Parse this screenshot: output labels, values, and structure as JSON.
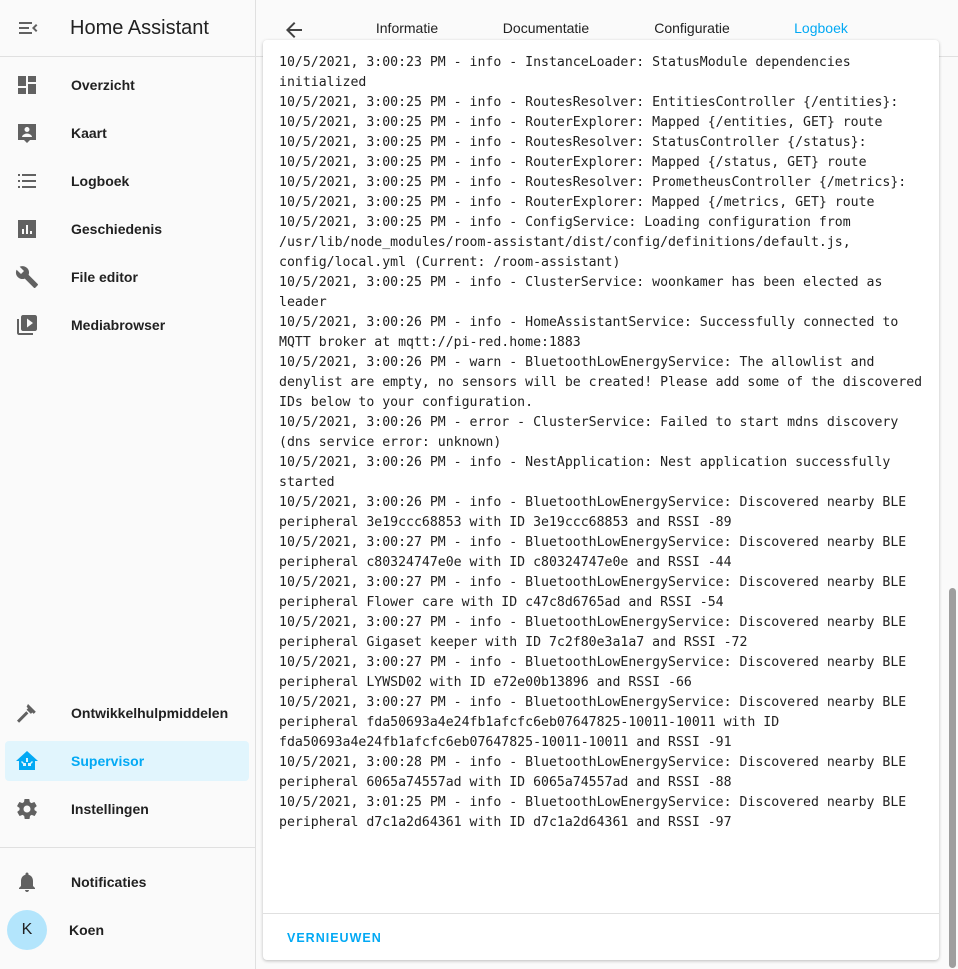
{
  "sidebar": {
    "title": "Home Assistant",
    "items": [
      {
        "label": "Overzicht",
        "icon": "dashboard-icon"
      },
      {
        "label": "Kaart",
        "icon": "map-icon"
      },
      {
        "label": "Logboek",
        "icon": "logbook-icon"
      },
      {
        "label": "Geschiedenis",
        "icon": "history-chart-icon"
      },
      {
        "label": "File editor",
        "icon": "wrench-icon"
      },
      {
        "label": "Mediabrowser",
        "icon": "media-icon"
      }
    ],
    "bottom_items": [
      {
        "label": "Ontwikkelhulpmiddelen",
        "icon": "hammer-icon"
      },
      {
        "label": "Supervisor",
        "icon": "supervisor-icon",
        "active": true
      },
      {
        "label": "Instellingen",
        "icon": "gear-icon"
      }
    ],
    "notifications_label": "Notificaties",
    "user": {
      "initial": "K",
      "name": "Koen"
    }
  },
  "header": {
    "tabs": [
      {
        "label": "Informatie"
      },
      {
        "label": "Documentatie"
      },
      {
        "label": "Configuratie"
      },
      {
        "label": "Logboek",
        "active": true
      }
    ]
  },
  "log": {
    "lines": [
      "10/5/2021, 3:00:23 PM - info - InstanceLoader: StatusModule dependencies initialized",
      "10/5/2021, 3:00:25 PM - info - RoutesResolver: EntitiesController {/entities}:",
      "10/5/2021, 3:00:25 PM - info - RouterExplorer: Mapped {/entities, GET} route",
      "10/5/2021, 3:00:25 PM - info - RoutesResolver: StatusController {/status}:",
      "10/5/2021, 3:00:25 PM - info - RouterExplorer: Mapped {/status, GET} route",
      "10/5/2021, 3:00:25 PM - info - RoutesResolver: PrometheusController {/metrics}:",
      "10/5/2021, 3:00:25 PM - info - RouterExplorer: Mapped {/metrics, GET} route",
      "10/5/2021, 3:00:25 PM - info - ConfigService: Loading configuration from /usr/lib/node_modules/room-assistant/dist/config/definitions/default.js, config/local.yml (Current: /room-assistant)",
      "10/5/2021, 3:00:25 PM - info - ClusterService: woonkamer has been elected as leader",
      "10/5/2021, 3:00:26 PM - info - HomeAssistantService: Successfully connected to MQTT broker at mqtt://pi-red.home:1883",
      "10/5/2021, 3:00:26 PM - warn - BluetoothLowEnergyService: The allowlist and denylist are empty, no sensors will be created! Please add some of the discovered IDs below to your configuration.",
      "10/5/2021, 3:00:26 PM - error - ClusterService: Failed to start mdns discovery (dns service error: unknown)",
      "10/5/2021, 3:00:26 PM - info - NestApplication: Nest application successfully started",
      "10/5/2021, 3:00:26 PM - info - BluetoothLowEnergyService: Discovered nearby BLE peripheral 3e19ccc68853 with ID 3e19ccc68853 and RSSI -89",
      "10/5/2021, 3:00:27 PM - info - BluetoothLowEnergyService: Discovered nearby BLE peripheral c80324747e0e with ID c80324747e0e and RSSI -44",
      "10/5/2021, 3:00:27 PM - info - BluetoothLowEnergyService: Discovered nearby BLE peripheral Flower care with ID c47c8d6765ad and RSSI -54",
      "10/5/2021, 3:00:27 PM - info - BluetoothLowEnergyService: Discovered nearby BLE peripheral Gigaset keeper with ID 7c2f80e3a1a7 and RSSI -72",
      "10/5/2021, 3:00:27 PM - info - BluetoothLowEnergyService: Discovered nearby BLE peripheral LYWSD02 with ID e72e00b13896 and RSSI -66",
      "10/5/2021, 3:00:27 PM - info - BluetoothLowEnergyService: Discovered nearby BLE peripheral fda50693a4e24fb1afcfc6eb07647825-10011-10011 with ID fda50693a4e24fb1afcfc6eb07647825-10011-10011 and RSSI -91",
      "10/5/2021, 3:00:28 PM - info - BluetoothLowEnergyService: Discovered nearby BLE peripheral 6065a74557ad with ID 6065a74557ad and RSSI -88",
      "10/5/2021, 3:01:25 PM - info - BluetoothLowEnergyService: Discovered nearby BLE peripheral d7c1a2d64361 with ID d7c1a2d64361 and RSSI -97"
    ]
  },
  "actions": {
    "refresh_label": "VERNIEUWEN"
  },
  "colors": {
    "accent": "#03a9f4",
    "active_background": "#e1f5fd",
    "icon": "#616161"
  }
}
